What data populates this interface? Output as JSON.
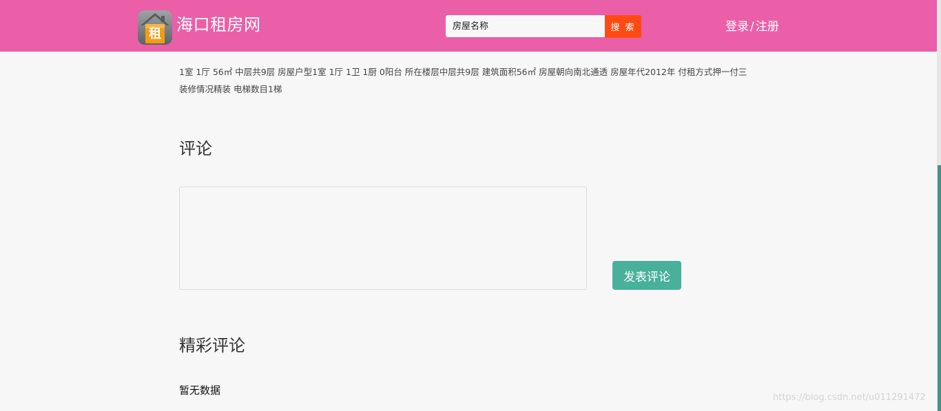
{
  "header": {
    "site_name": "海口租房网",
    "logo_glyph": "租",
    "search": {
      "placeholder": "房屋名称",
      "value": "",
      "button_label": "搜 索"
    },
    "auth": {
      "login": "登录",
      "separator": "/",
      "register": "注册"
    },
    "colors": {
      "header_bg": "#ea5fa8",
      "search_button": "#ff4b13",
      "submit_button": "#48b09b"
    }
  },
  "listing": {
    "details_line1": "1室 1厅 56㎡ 中层共9层 房屋户型1室 1厅 1卫 1厨 0阳台 所在楼层中层共9层 建筑面积56㎡ 房屋朝向南北通透 房屋年代2012年 付租方式押一付三",
    "details_line2": "装修情况精装 电梯数目1梯"
  },
  "comment": {
    "title": "评论",
    "textarea_value": "",
    "submit_label": "发表评论"
  },
  "featured_comments": {
    "title": "精彩评论",
    "empty_text": "暂无数据"
  },
  "watermark": "https://blog.csdn.net/u011291472"
}
